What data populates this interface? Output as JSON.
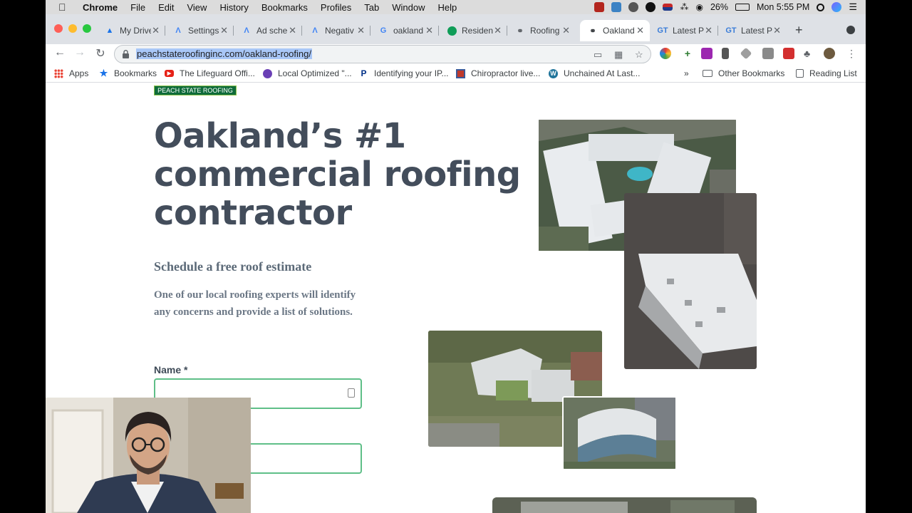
{
  "menubar": {
    "app": "Chrome",
    "items": [
      "File",
      "Edit",
      "View",
      "History",
      "Bookmarks",
      "Profiles",
      "Tab",
      "Window",
      "Help"
    ],
    "battery": "26%",
    "clock": "Mon 5:55 PM"
  },
  "tabs": [
    {
      "favicon": "google-drive-icon",
      "title": "My Drive"
    },
    {
      "favicon": "google-ads-icon",
      "title": "Settings"
    },
    {
      "favicon": "google-ads-icon",
      "title": "Ad sche"
    },
    {
      "favicon": "google-ads-icon",
      "title": "Negativ"
    },
    {
      "favicon": "google-g-icon",
      "title": "oakland"
    },
    {
      "favicon": "green-circle-icon",
      "title": "Residen"
    },
    {
      "favicon": "globe-icon",
      "title": "Roofing"
    },
    {
      "favicon": "globe-icon",
      "title": "Oakland"
    },
    {
      "favicon": "gt-icon",
      "title": "Latest P"
    },
    {
      "favicon": "gt-icon",
      "title": "Latest P"
    }
  ],
  "active_tab_index": 7,
  "address_bar": {
    "url": "peachstateroofinginc.com/oakland-roofing/"
  },
  "bookmarks": {
    "apps": "Apps",
    "bookmarks": "Bookmarks",
    "lifeguard": "The Lifeguard Offi...",
    "local": "Local Optimized \"...",
    "identifying": "Identifying your IP...",
    "chiro": "Chiropractor live...",
    "unchained": "Unchained At Last...",
    "more": "»",
    "other": "Other Bookmarks",
    "reading": "Reading List"
  },
  "page": {
    "logo_text": "PEACH STATE ROOFING",
    "headline_line1": "Oakland’s #1",
    "headline_line2": "commercial roofing",
    "headline_line3": "contractor",
    "subheading": "Schedule a free roof estimate",
    "description": "One of our local roofing experts will identify any concerns and provide a list of solutions.",
    "name_label": "Name *"
  },
  "colors": {
    "headline": "#434d5b",
    "field_border": "#5fbf88",
    "logo_bg": "#0f6b3a"
  }
}
